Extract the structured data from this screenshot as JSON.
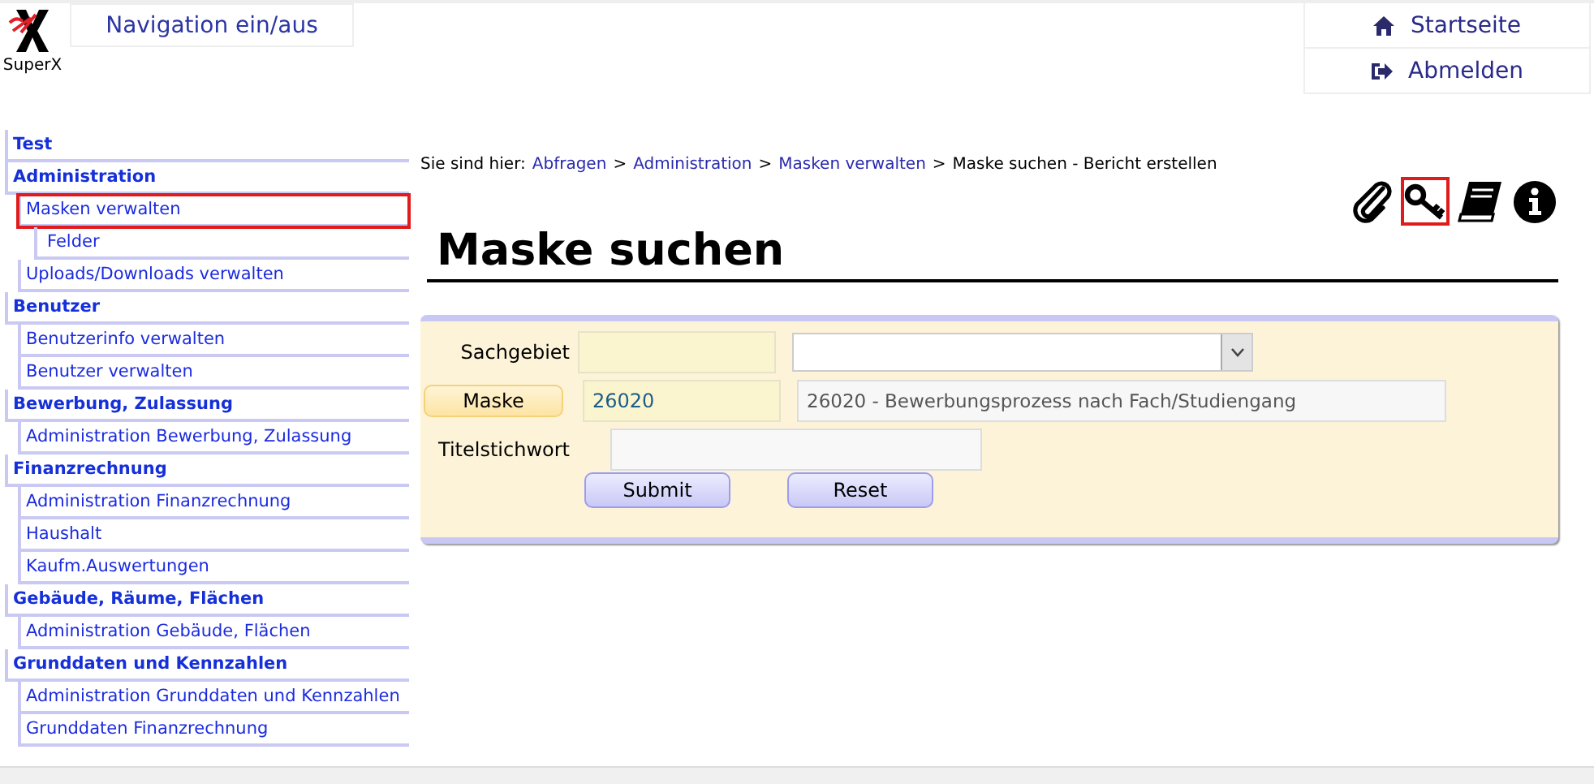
{
  "logo": {
    "caption": "SuperX"
  },
  "nav_toggle": {
    "label": "Navigation ein/aus"
  },
  "top_links": [
    {
      "kind": "home",
      "label": "Startseite"
    },
    {
      "kind": "logout",
      "label": "Abmelden"
    }
  ],
  "sidebar": {
    "items": [
      {
        "label": "Test",
        "highlighted": false
      },
      {
        "label": "Administration",
        "highlighted": false,
        "children": [
          {
            "label": "Masken verwalten",
            "highlighted": true,
            "children": [
              {
                "label": "Felder",
                "highlighted": false
              }
            ]
          },
          {
            "label": "Uploads/Downloads verwalten",
            "highlighted": false
          }
        ]
      },
      {
        "label": "Benutzer",
        "highlighted": false,
        "children": [
          {
            "label": "Benutzerinfo verwalten",
            "highlighted": false
          },
          {
            "label": "Benutzer verwalten",
            "highlighted": false
          }
        ]
      },
      {
        "label": "Bewerbung, Zulassung",
        "highlighted": false,
        "children": [
          {
            "label": "Administration Bewerbung, Zulassung",
            "highlighted": false
          }
        ]
      },
      {
        "label": "Finanzrechnung",
        "highlighted": false,
        "children": [
          {
            "label": "Administration Finanzrechnung",
            "highlighted": false
          },
          {
            "label": "Haushalt",
            "highlighted": false
          },
          {
            "label": "Kaufm.Auswertungen",
            "highlighted": false
          }
        ]
      },
      {
        "label": "Gebäude, Räume, Flächen",
        "highlighted": false,
        "children": [
          {
            "label": "Administration Gebäude, Flächen",
            "highlighted": false
          }
        ]
      },
      {
        "label": "Grunddaten und Kennzahlen",
        "highlighted": false,
        "children": [
          {
            "label": "Administration Grunddaten und Kennzahlen",
            "highlighted": false
          },
          {
            "label": "Grunddaten Finanzrechnung",
            "highlighted": false
          }
        ]
      }
    ]
  },
  "breadcrumb": {
    "prefix": "Sie sind hier:",
    "links": [
      "Abfragen",
      "Administration",
      "Masken verwalten"
    ],
    "separator": ">",
    "current": "Maske suchen - Bericht erstellen"
  },
  "tool_icons": [
    {
      "kind": "attachment",
      "highlighted": false
    },
    {
      "kind": "key",
      "highlighted": true
    },
    {
      "kind": "book",
      "highlighted": false
    },
    {
      "kind": "info",
      "highlighted": false
    }
  ],
  "heading": "Maske suchen",
  "form": {
    "rows": [
      {
        "kind": "select",
        "label": "Sachgebiet"
      },
      {
        "kind": "lookup",
        "label": "Maske",
        "value": "26020",
        "description": "26020 - Bewerbungsprozess nach Fach/Studiengang"
      },
      {
        "kind": "text",
        "label": "Titelstichwort"
      }
    ],
    "buttons": [
      "Submit",
      "Reset"
    ]
  }
}
